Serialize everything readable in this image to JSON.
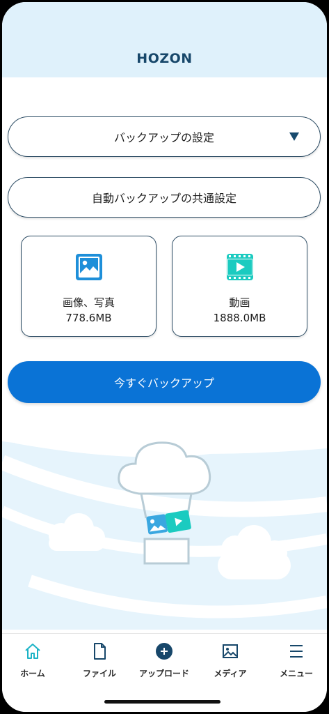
{
  "app": {
    "logo": "HOZON"
  },
  "settings": {
    "backup_settings_label": "バックアップの設定",
    "common_settings_label": "自動バックアップの共通設定"
  },
  "cards": {
    "photos": {
      "label": "画像、写真",
      "size": "778.6MB",
      "icon": "image-icon"
    },
    "videos": {
      "label": "動画",
      "size": "1888.0MB",
      "icon": "video-icon"
    }
  },
  "actions": {
    "backup_now_label": "今すぐバックアップ"
  },
  "tabs": [
    {
      "label": "ホーム",
      "icon": "home-icon",
      "active": true
    },
    {
      "label": "ファイル",
      "icon": "file-icon"
    },
    {
      "label": "アップロード",
      "icon": "plus-circle-icon"
    },
    {
      "label": "メディア",
      "icon": "media-icon"
    },
    {
      "label": "メニュー",
      "icon": "menu-icon"
    }
  ],
  "colors": {
    "brand": "#17476a",
    "primary_button": "#0a73d6",
    "active_tab": "#1bb3c6",
    "header_bg": "#dff1fb"
  }
}
